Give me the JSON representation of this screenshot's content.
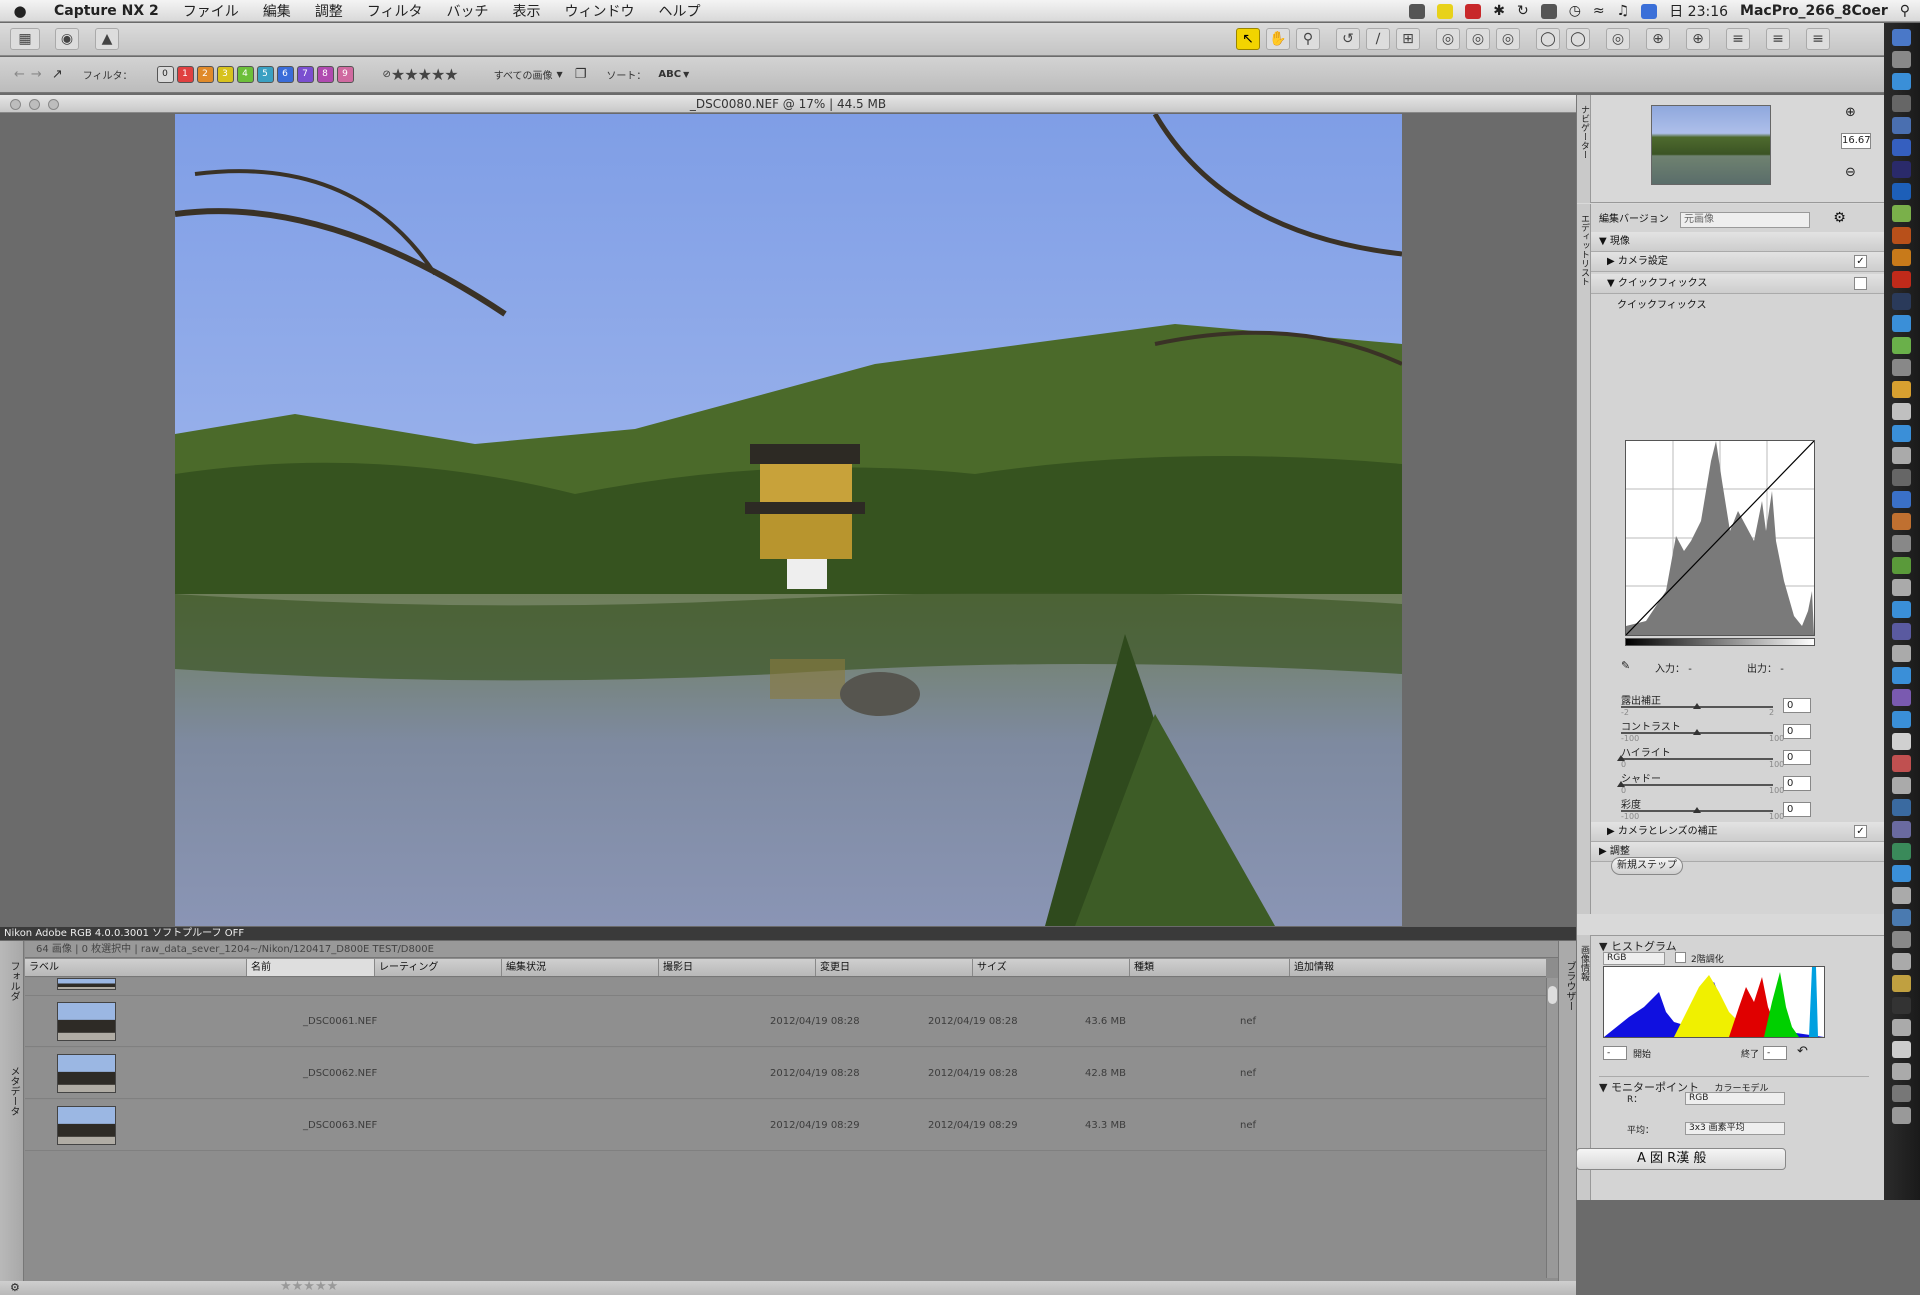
{
  "menubar": {
    "app_name": "Capture NX 2",
    "items": [
      "ファイル",
      "編集",
      "調整",
      "フィルタ",
      "バッチ",
      "表示",
      "ウィンドウ",
      "ヘルプ"
    ],
    "clock": "日 23:16",
    "host": "MacPro_266_8Coer"
  },
  "filterbar": {
    "filter_label": "フィルタ：",
    "label_numbers": [
      "0",
      "1",
      "2",
      "3",
      "4",
      "5",
      "6",
      "7",
      "8",
      "9"
    ],
    "label_colors": [
      "#d9d9d9",
      "#e04040",
      "#e08a2a",
      "#d7c21d",
      "#6cbf3a",
      "#3aa0c2",
      "#3a6cd9",
      "#7a4fd0",
      "#b04ab0",
      "#d06aa0"
    ],
    "rating_stars": "★★★★★",
    "all_images": "すべての画像",
    "sort_label": "ソート：",
    "sort_value": "ABC"
  },
  "document": {
    "title": "_DSC0080.NEF @ 17% | 44.5 MB",
    "soft_proof": "Nikon Adobe RGB 4.0.0.3001  ソフトプルーフ OFF"
  },
  "browser": {
    "path_info": "64 画像 | 0 枚選択中 | raw_data_sever_1204~/Nikon/120417_D800E TEST/D800E",
    "left_tab_folder": "フォルダ",
    "left_tab_metadata": "メタデータ",
    "right_tab": "ブラウザー",
    "columns": [
      "ラベル",
      "名前",
      "レーティング",
      "編集状況",
      "撮影日",
      "変更日",
      "サイズ",
      "種類",
      "追加情報"
    ],
    "rows": [
      {
        "name": "_DSC0061.NEF",
        "shot": "2012/04/19 08:28",
        "modified": "2012/04/19 08:28",
        "size": "43.6 MB",
        "kind": "nef"
      },
      {
        "name": "_DSC0062.NEF",
        "shot": "2012/04/19 08:28",
        "modified": "2012/04/19 08:28",
        "size": "42.8 MB",
        "kind": "nef"
      },
      {
        "name": "_DSC0063.NEF",
        "shot": "2012/04/19 08:29",
        "modified": "2012/04/19 08:29",
        "size": "43.3 MB",
        "kind": "nef"
      }
    ]
  },
  "navigator": {
    "tab": "ナビゲーター",
    "zoom": "16.67"
  },
  "editlist": {
    "tab": "エディットリスト",
    "version_label": "編集バージョン",
    "version_value": "元画像",
    "develop": "現像",
    "camera_settings": "カメラ設定",
    "quick_fix": "クイックフィックス",
    "quick_fix_sub": "クイックフィックス",
    "input_label": "入力：",
    "input_value": "-",
    "output_label": "出力：",
    "output_value": "-",
    "sliders": [
      {
        "name": "露出補正",
        "min": "-2",
        "max": "2",
        "value": "0",
        "pos": 0.5
      },
      {
        "name": "コントラスト",
        "min": "-100",
        "max": "100",
        "value": "0",
        "pos": 0.5
      },
      {
        "name": "ハイライト",
        "min": "0",
        "max": "100",
        "value": "0",
        "pos": 0.0
      },
      {
        "name": "シャドー",
        "min": "0",
        "max": "100",
        "value": "0",
        "pos": 0.0
      },
      {
        "name": "彩度",
        "min": "-100",
        "max": "100",
        "value": "0",
        "pos": 0.5
      }
    ],
    "camera_lens": "カメラとレンズの補正",
    "adjust": "調整",
    "new_step": "新規ステップ"
  },
  "histogram": {
    "tab": "画像情報",
    "title": "ヒストグラム",
    "channel": "RGB",
    "posterize": "2階調化",
    "start_label": "開始",
    "start_value": "-",
    "end_label": "終了",
    "end_value": "-",
    "monitor_point": "モニターポイント",
    "color_model_label": "カラーモデル",
    "color_model": "RGB",
    "r_label": "R：",
    "average_label": "平均：",
    "average_value": "3x3 画素平均"
  },
  "ime": {
    "text": "A 囡 R漢 般"
  }
}
